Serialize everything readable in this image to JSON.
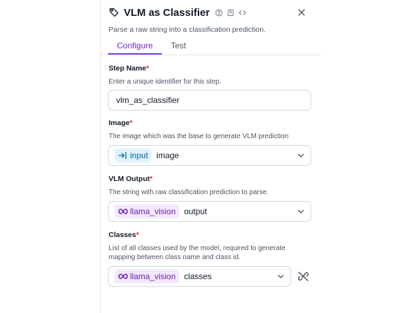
{
  "header": {
    "title": "VLM as Classifier",
    "description": "Parse a raw string into a classification prediction."
  },
  "tabs": [
    {
      "label": "Configure",
      "active": true
    },
    {
      "label": "Test",
      "active": false
    }
  ],
  "fields": {
    "step_name": {
      "label": "Step Name",
      "required_mark": "*",
      "help": "Enter a unique identifier for this step.",
      "value": "vlm_as_classifier"
    },
    "image": {
      "label": "Image",
      "required_mark": "*",
      "help": "The image which was the base to generate VLM prediction",
      "chip": "input",
      "value": "image"
    },
    "vlm_output": {
      "label": "VLM Output",
      "required_mark": "*",
      "help": "The string with raw classification prediction to parse.",
      "chip": "llama_vision",
      "value": "output"
    },
    "classes": {
      "label": "Classes",
      "required_mark": "*",
      "help_line1": "List of all classes used by the model, required to generate",
      "help_line2": "mapping between class name and class id.",
      "chip": "llama_vision",
      "value": "classes"
    }
  },
  "icons": {
    "tag": "tag-icon",
    "help": "help-circle-icon",
    "docs": "book-icon",
    "code": "code-icon",
    "close": "close-icon",
    "input": "input-arrow-icon",
    "meta": "meta-infinity-icon",
    "chevron": "chevron-down-icon",
    "unlink": "unlink-icon"
  },
  "colors": {
    "accent": "#7c3aed",
    "required": "#dc2626",
    "input_chip_bg": "#e0f2fe",
    "input_chip_fg": "#0369a1",
    "meta_chip_bg": "#f3e8ff",
    "meta_chip_fg": "#6b21a8"
  }
}
